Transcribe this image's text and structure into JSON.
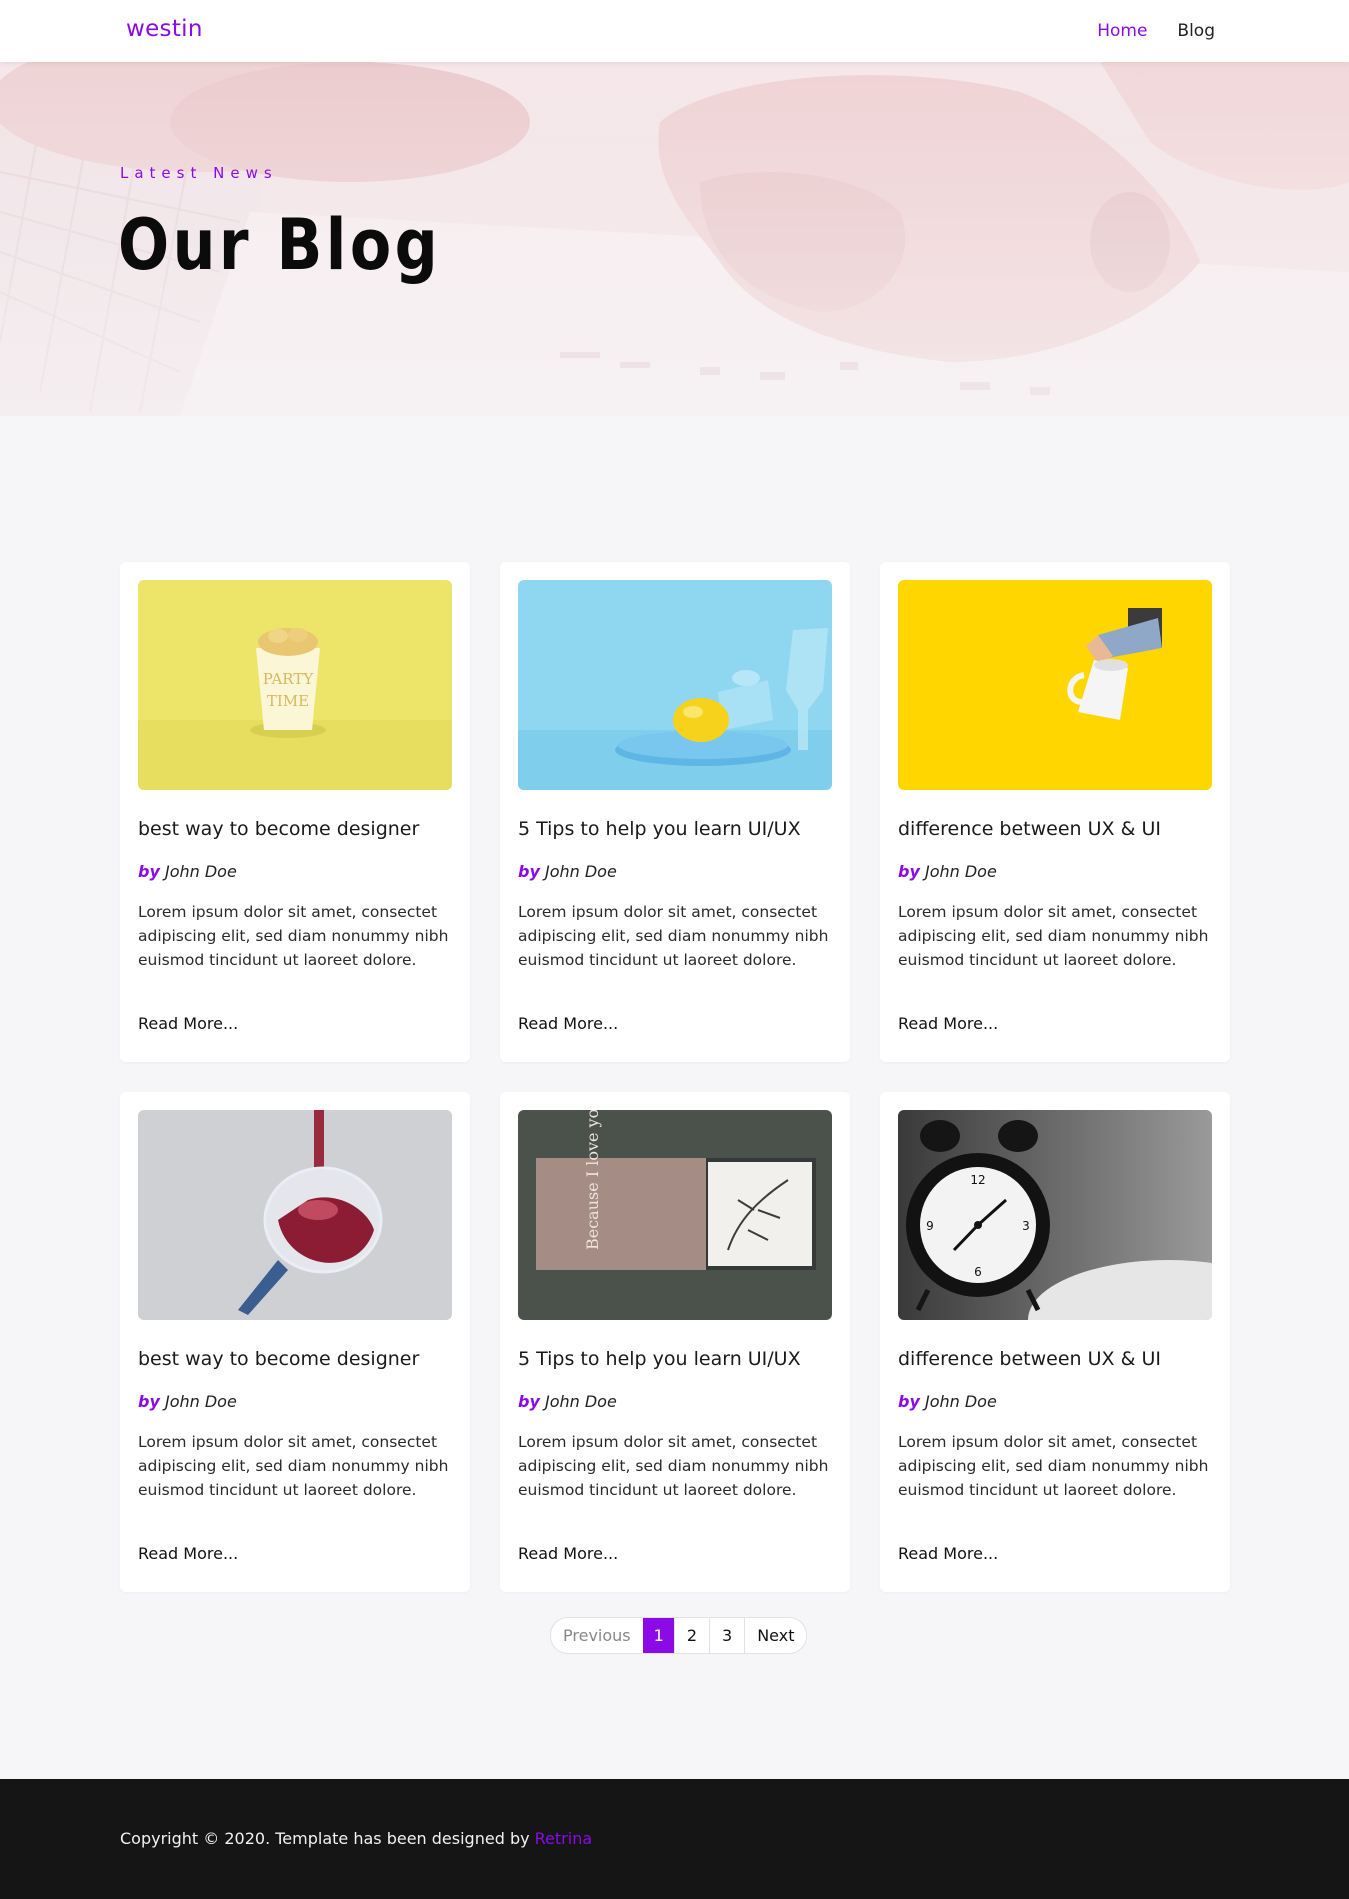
{
  "header": {
    "logo": "westin",
    "nav": [
      {
        "label": "Home",
        "active": true
      },
      {
        "label": "Blog",
        "active": false
      }
    ]
  },
  "hero": {
    "eyebrow": "Latest News",
    "title": "Our Blog"
  },
  "posts": [
    {
      "title": "best way to become designer",
      "by": "by",
      "author": "John Doe",
      "excerpt": "Lorem ipsum dolor sit amet, consectet adipiscing elit, sed diam nonummy nibh euismod tincidunt ut laoreet dolore.",
      "read_more": "Read More...",
      "image": "party-cup"
    },
    {
      "title": "5 Tips to help you learn UI/UX",
      "by": "by",
      "author": "John Doe",
      "excerpt": "Lorem ipsum dolor sit amet, consectet adipiscing elit, sed diam nonummy nibh euismod tincidunt ut laoreet dolore.",
      "read_more": "Read More...",
      "image": "lemon-plate"
    },
    {
      "title": "difference between UX & UI",
      "by": "by",
      "author": "John Doe",
      "excerpt": "Lorem ipsum dolor sit amet, consectet adipiscing elit, sed diam nonummy nibh euismod tincidunt ut laoreet dolore.",
      "read_more": "Read More...",
      "image": "hand-mug"
    },
    {
      "title": "best way to become designer",
      "by": "by",
      "author": "John Doe",
      "excerpt": "Lorem ipsum dolor sit amet, consectet adipiscing elit, sed diam nonummy nibh euismod tincidunt ut laoreet dolore.",
      "read_more": "Read More...",
      "image": "wine-glass"
    },
    {
      "title": "5 Tips to help you learn UI/UX",
      "by": "by",
      "author": "John Doe",
      "excerpt": "Lorem ipsum dolor sit amet, consectet adipiscing elit, sed diam nonummy nibh euismod tincidunt ut laoreet dolore.",
      "read_more": "Read More...",
      "image": "gift-box",
      "image_text": "Because I love you."
    },
    {
      "title": "difference between UX & UI",
      "by": "by",
      "author": "John Doe",
      "excerpt": "Lorem ipsum dolor sit amet, consectet adipiscing elit, sed diam nonummy nibh euismod tincidunt ut laoreet dolore.",
      "read_more": "Read More...",
      "image": "alarm-clock"
    }
  ],
  "pagination": {
    "previous": "Previous",
    "pages": [
      "1",
      "2",
      "3"
    ],
    "current": "1",
    "next": "Next"
  },
  "footer": {
    "copyright": "Copyright © 2020. Template has been designed by",
    "designer": "Retrina"
  },
  "colors": {
    "accent": "#8b0ae6",
    "footer_bg": "#151515",
    "page_bg": "#f6f5f7"
  }
}
